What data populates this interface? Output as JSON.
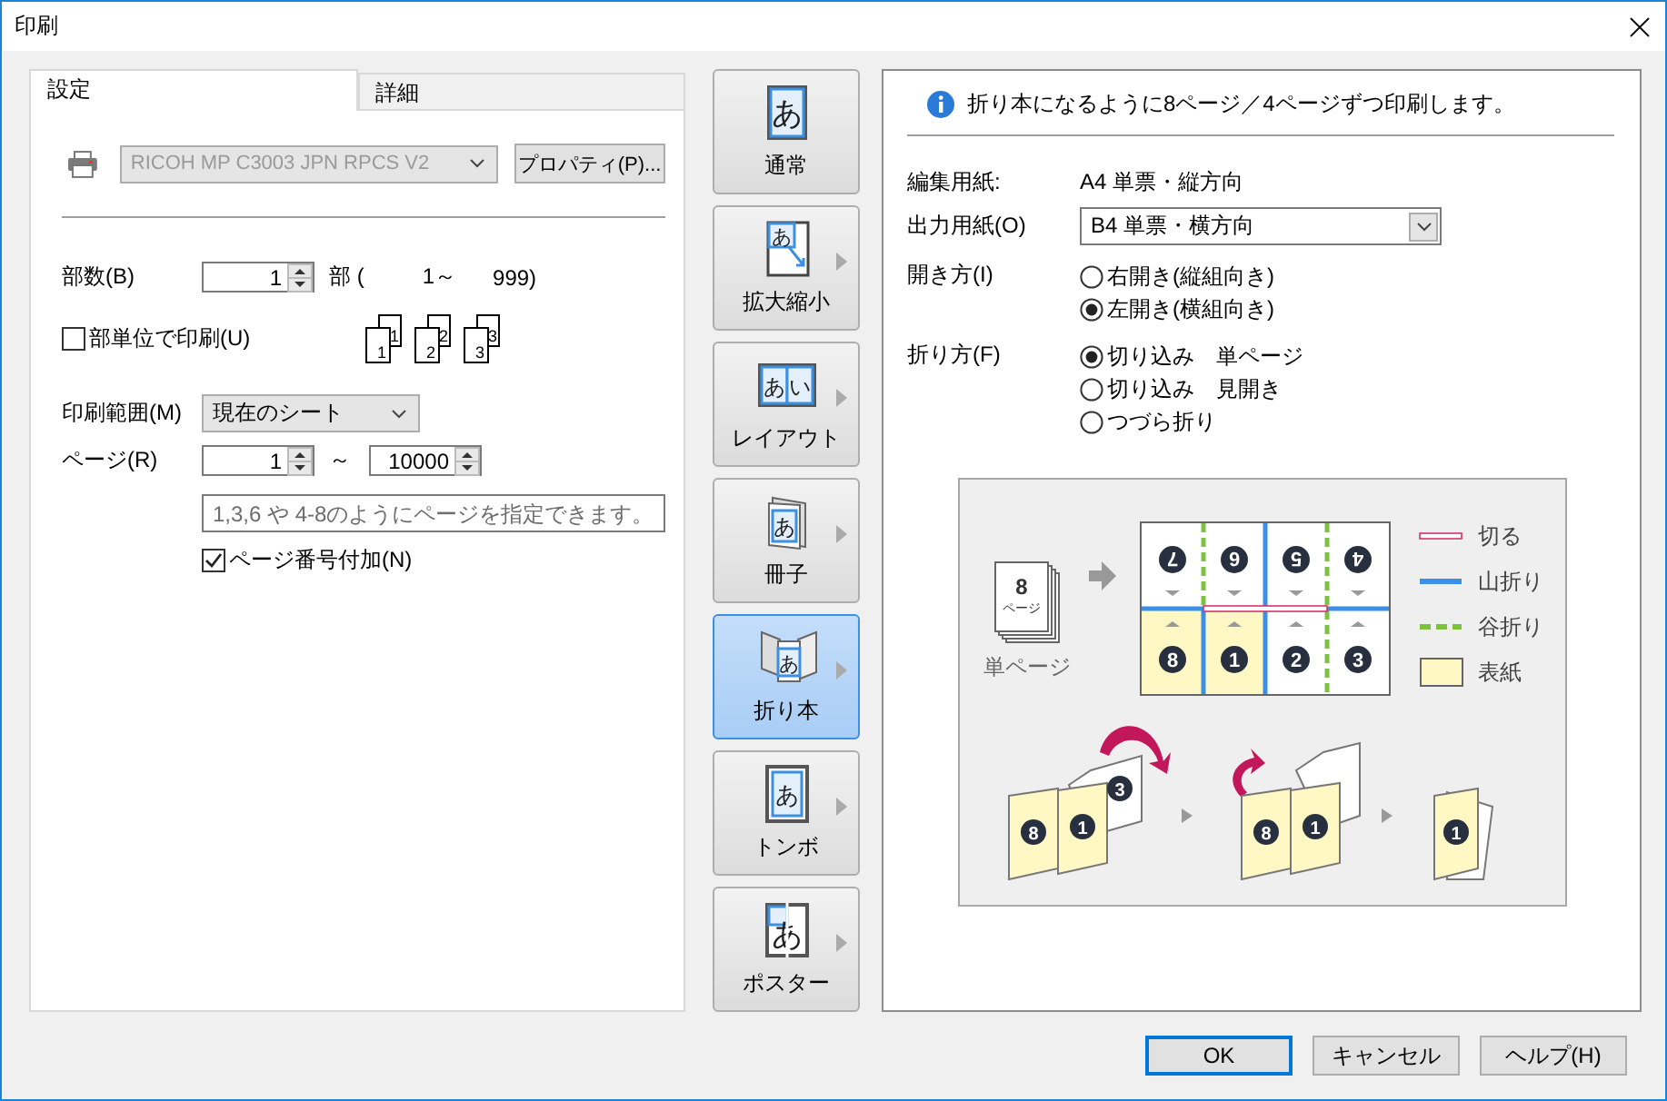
{
  "window": {
    "title": "印刷"
  },
  "tabs": [
    {
      "label": "設定",
      "selected": true
    },
    {
      "label": "詳細",
      "selected": false
    }
  ],
  "printer": {
    "value": "RICOH MP C3003 JPN RPCS V2",
    "properties_button": "プロパティ(P)..."
  },
  "copies": {
    "label": "部数(B)",
    "value": "1",
    "unit": "部 (",
    "range_min": "1～",
    "range_max": "999)"
  },
  "collate": {
    "label": "部単位で印刷(U)",
    "checked": false,
    "sheets": [
      {
        "back": "1",
        "front": "1"
      },
      {
        "back": "2",
        "front": "2"
      },
      {
        "back": "3",
        "front": "3"
      }
    ]
  },
  "print_range": {
    "label": "印刷範囲(M)",
    "value": "現在のシート"
  },
  "pages": {
    "label": "ページ(R)",
    "from": "1",
    "separator": "～",
    "to": "10000",
    "hint": "1,3,6 や 4-8のようにページを指定できます。"
  },
  "page_numbering": {
    "label": "ページ番号付加(N)",
    "checked": true
  },
  "modes": [
    {
      "label": "通常",
      "kind": "normal",
      "icon_text": "あ",
      "selected": false,
      "submenu": false
    },
    {
      "label": "拡大縮小",
      "kind": "scale",
      "icon_text": "あ",
      "selected": false,
      "submenu": true
    },
    {
      "label": "レイアウト",
      "kind": "layout",
      "icon_text": "あい",
      "selected": false,
      "submenu": true
    },
    {
      "label": "冊子",
      "kind": "booklet",
      "icon_text": "あ",
      "selected": false,
      "submenu": true
    },
    {
      "label": "折り本",
      "kind": "folded",
      "icon_text": "あ",
      "selected": true,
      "submenu": true
    },
    {
      "label": "トンボ",
      "kind": "cropmarks",
      "icon_text": "あ",
      "selected": false,
      "submenu": true
    },
    {
      "label": "ポスター",
      "kind": "poster",
      "icon_text": "あ",
      "selected": false,
      "submenu": true
    }
  ],
  "info": "折り本になるように8ページ／4ページずつ印刷します。",
  "edit_paper": {
    "label": "編集用紙:",
    "value": "A4 単票・縦方向"
  },
  "output_paper": {
    "label": "出力用紙(O)",
    "value": "B4 単票・横方向"
  },
  "opening": {
    "label": "開き方(I)",
    "options": [
      {
        "label": "右開き(縦組向き)",
        "selected": false
      },
      {
        "label": "左開き(横組向き)",
        "selected": true
      }
    ]
  },
  "folding": {
    "label": "折り方(F)",
    "options": [
      {
        "label": "切り込み　単ページ",
        "selected": true
      },
      {
        "label": "切り込み　見開き",
        "selected": false
      },
      {
        "label": "つづら折り",
        "selected": false
      }
    ]
  },
  "diagram": {
    "stack_count": "8",
    "stack_unit": "ページ",
    "stack_caption": "単ページ",
    "sheet": [
      {
        "number": "7",
        "flipped": true,
        "cover": false
      },
      {
        "number": "6",
        "flipped": true,
        "cover": false
      },
      {
        "number": "5",
        "flipped": true,
        "cover": false
      },
      {
        "number": "4",
        "flipped": true,
        "cover": false
      },
      {
        "number": "8",
        "flipped": false,
        "cover": true
      },
      {
        "number": "1",
        "flipped": false,
        "cover": true
      },
      {
        "number": "2",
        "flipped": false,
        "cover": false
      },
      {
        "number": "3",
        "flipped": false,
        "cover": false
      }
    ],
    "legend": [
      {
        "kind": "cut",
        "label": "切る"
      },
      {
        "kind": "mountain",
        "label": "山折り"
      },
      {
        "kind": "valley",
        "label": "谷折り"
      },
      {
        "kind": "cover",
        "label": "表紙"
      }
    ],
    "steps": [
      {
        "numbers": [
          "8",
          "1",
          "3"
        ]
      },
      {
        "numbers": [
          "8",
          "1"
        ]
      },
      {
        "numbers": [
          "1"
        ]
      }
    ]
  },
  "buttons": [
    {
      "label": "OK",
      "default": true
    },
    {
      "label": "キャンセル",
      "default": false
    },
    {
      "label": "ヘルプ(H)",
      "default": false
    }
  ]
}
